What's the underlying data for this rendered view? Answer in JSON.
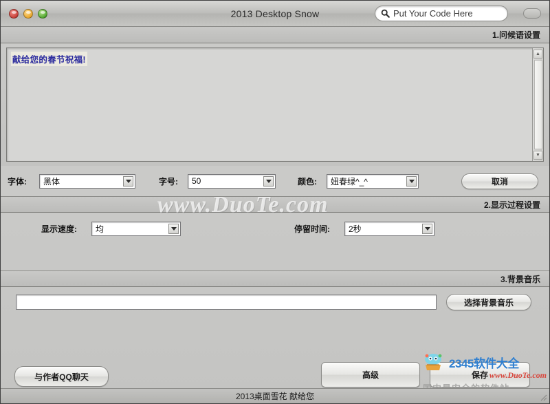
{
  "window": {
    "title": "2013 Desktop Snow",
    "traffic_lights": [
      "close-red",
      "minimize-yellow",
      "zoom-green"
    ]
  },
  "search": {
    "icon": "search-icon",
    "placeholder": "Put Your Code Here",
    "value": ""
  },
  "toolbar_toggle": {
    "name": "toolbar-toggle-button"
  },
  "sections": {
    "greeting": {
      "header": "1.问候语设置",
      "textarea_value": "献给您的春节祝福!",
      "font": {
        "label": "字体:",
        "value": "黑体"
      },
      "size": {
        "label": "字号:",
        "value": "50"
      },
      "color": {
        "label": "颜色:",
        "value": "妞春绿^_^"
      },
      "cancel_button": "取消"
    },
    "display": {
      "header": "2.显示过程设置",
      "speed": {
        "label": "显示速度:",
        "value": "均"
      },
      "stay": {
        "label": "停留时间:",
        "value": "2秒"
      }
    },
    "music": {
      "header": "3.背景音乐",
      "path_value": "",
      "choose_button": "选择背景音乐"
    }
  },
  "footer": {
    "qq_button": "与作者QQ聊天",
    "advanced_button": "高级",
    "save_button": "保存",
    "status_text": "2013桌面雪花 献给您"
  },
  "watermarks": {
    "center": "www.DuoTe.com",
    "brand": "2345软件大全",
    "site": "www.DuoTe.com",
    "tagline": "国内最安全的软件站"
  },
  "colors": {
    "greeting_text": "#2a2a9e",
    "brand_blue": "#2f7fd0",
    "site_red": "#d8463c"
  }
}
